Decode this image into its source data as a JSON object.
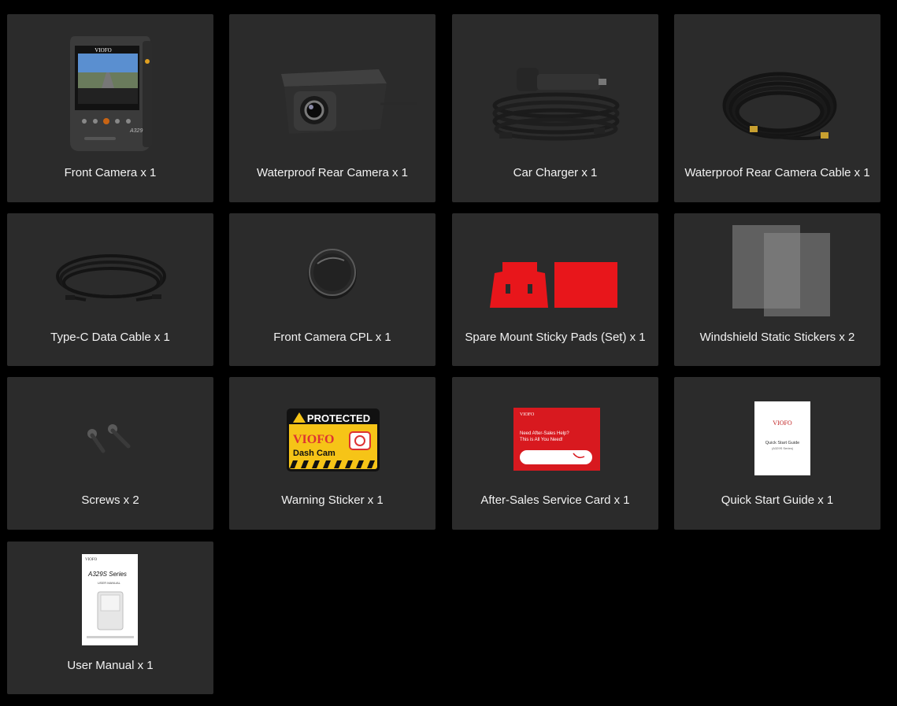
{
  "items": [
    {
      "label": "Front Camera x 1",
      "icon": "dash-camera-icon",
      "screen_text": {
        "brand": "VIOFO",
        "model": "A329"
      }
    },
    {
      "label": "Waterproof Rear Camera x 1",
      "icon": "rear-camera-icon"
    },
    {
      "label": "Car Charger x 1",
      "icon": "car-charger-icon"
    },
    {
      "label": "Waterproof Rear Camera Cable x 1",
      "icon": "coiled-cable-icon"
    },
    {
      "label": "Type-C Data Cable x 1",
      "icon": "usb-cable-icon"
    },
    {
      "label": "Front Camera CPL x 1",
      "icon": "cpl-filter-icon"
    },
    {
      "label": "Spare Mount Sticky Pads (Set) x 1",
      "icon": "sticky-pads-icon"
    },
    {
      "label": "Windshield Static Stickers x 2",
      "icon": "static-stickers-icon"
    },
    {
      "label": "Screws x 2",
      "icon": "screws-icon"
    },
    {
      "label": "Warning Sticker x 1",
      "icon": "warning-sticker-icon",
      "sticker_text": {
        "top": "PROTECTED",
        "brand": "VIOFO",
        "sub": "Dash Cam"
      }
    },
    {
      "label": "After-Sales Service Card x 1",
      "icon": "service-card-icon",
      "card_text": {
        "brand": "VIOFO",
        "line1": "Need After-Sales Help?",
        "line2": "This is All You Need!"
      }
    },
    {
      "label": "Quick Start Guide x 1",
      "icon": "quick-start-guide-icon",
      "guide_text": {
        "brand": "VIOFO",
        "title": "Quick Start Guide",
        "sub": "(A329S Series)"
      }
    },
    {
      "label": "User Manual x 1",
      "icon": "user-manual-icon",
      "manual_text": {
        "brand": "VIOFO",
        "title": "A329S Series",
        "sub": "USER MANUAL"
      }
    }
  ],
  "colors": {
    "page_bg": "#000000",
    "card_bg": "#2b2b2b",
    "label": "#f2f2f2",
    "pad_red": "#e8161b",
    "sticker_yellow": "#f6c417"
  }
}
